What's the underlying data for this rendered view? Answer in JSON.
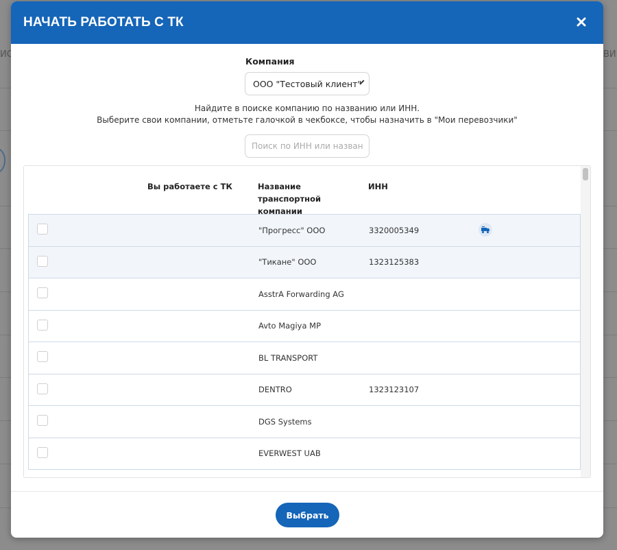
{
  "background": {
    "left_text": "ИСС",
    "right_text": "ВИ"
  },
  "modal": {
    "title": "НАЧАТЬ РАБОТАТЬ С ТК",
    "close_icon": "×"
  },
  "company": {
    "label": "Компания",
    "selected": "ООО \"Тестовый клиент\""
  },
  "hint": {
    "line1": "Найдите в поиске компанию по названию или ИНН.",
    "line2": "Выберите свои компании, отметьте галочкой в чекбоксе, чтобы назначить в \"Мои перевозчики\""
  },
  "search": {
    "placeholder": "Поиск по ИНН или названию",
    "value": ""
  },
  "table": {
    "headers": {
      "works_with": "Вы работаете с ТК",
      "name": "Название транспортной компании",
      "inn": "ИНН"
    },
    "rows": [
      {
        "name": "\"Прогресс\" ООО",
        "inn": "3320005349",
        "checked": false,
        "has_icon": true
      },
      {
        "name": "\"Тикане\" ООО",
        "inn": "1323125383",
        "checked": false,
        "has_icon": false
      },
      {
        "name": "AsstrA Forwarding AG",
        "inn": "",
        "checked": false,
        "has_icon": false
      },
      {
        "name": "Avto Magiya MP",
        "inn": "",
        "checked": false,
        "has_icon": false
      },
      {
        "name": "BL TRANSPORT",
        "inn": "",
        "checked": false,
        "has_icon": false
      },
      {
        "name": "DENTRO",
        "inn": "1323123107",
        "checked": false,
        "has_icon": false
      },
      {
        "name": "DGS Systems",
        "inn": "",
        "checked": false,
        "has_icon": false
      },
      {
        "name": "EVERWEST UAB",
        "inn": "",
        "checked": false,
        "has_icon": false
      }
    ]
  },
  "footer": {
    "select_label": "Выбрать"
  },
  "colors": {
    "brand": "#1565b8",
    "row_border": "#cdd9e6"
  },
  "icons": {
    "row_action": "truck-transfer-icon",
    "close": "close-icon",
    "dropdown": "chevron-down-icon"
  }
}
